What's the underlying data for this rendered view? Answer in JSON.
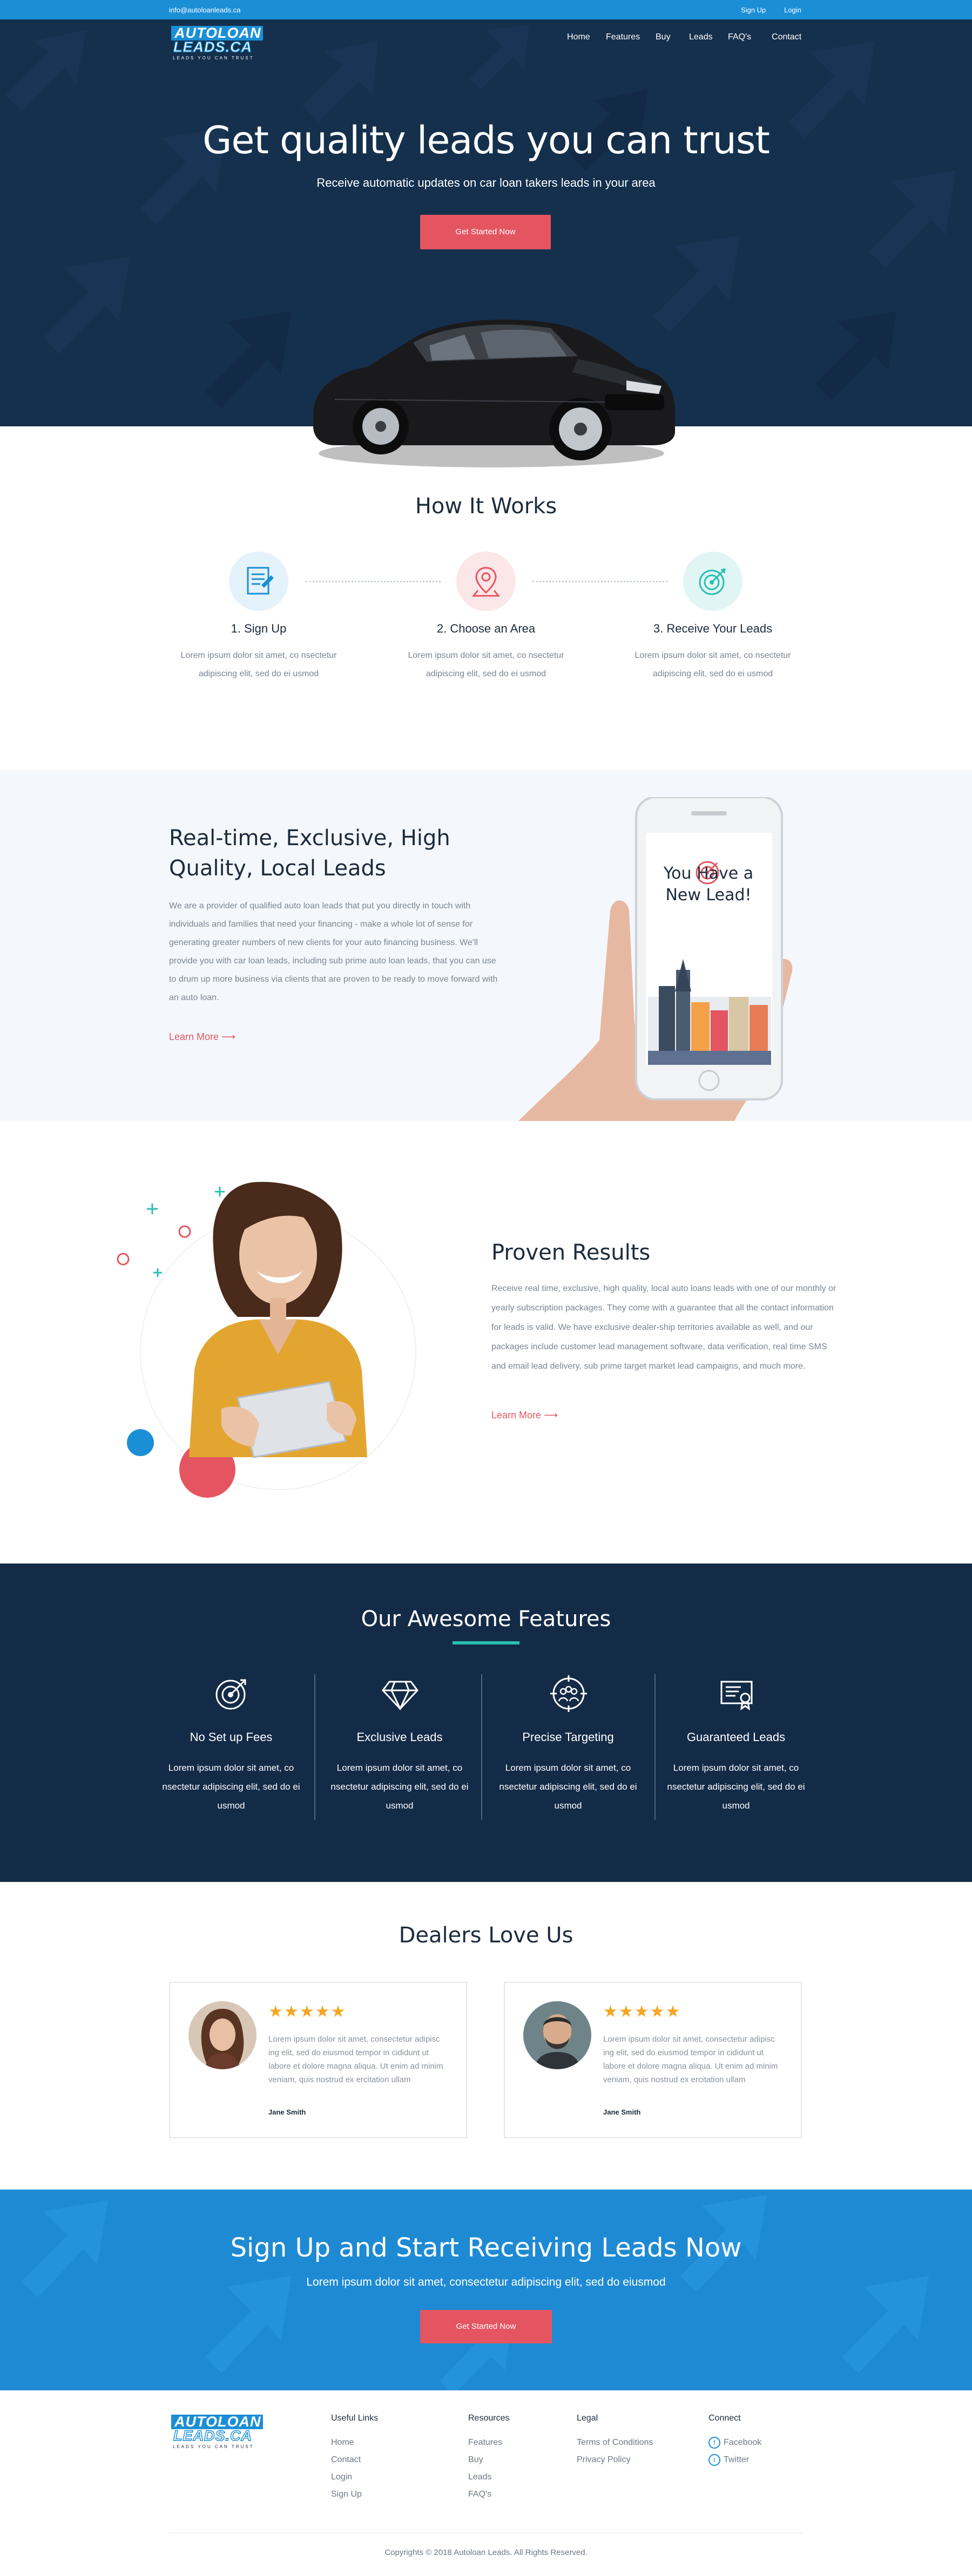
{
  "topbar": {
    "email": "info@autoloanleads.ca",
    "signup": "Sign Up",
    "login": "Login"
  },
  "brand": {
    "line1": "AUTOLOAN",
    "line2": "LEADS.CA",
    "tagline": "LEADS YOU CAN TRUST"
  },
  "nav": {
    "items": [
      "Home",
      "Features",
      "Buy",
      "Leads",
      "FAQ's",
      "Contact"
    ]
  },
  "hero": {
    "title": "Get quality leads you can trust",
    "subtitle": "Receive automatic updates on car loan takers leads in your area",
    "cta": "Get Started Now"
  },
  "how": {
    "title": "How It Works",
    "steps": [
      {
        "title": "1. Sign Up",
        "text": "Lorem ipsum dolor sit amet,  co nsectetur adipiscing elit, sed do ei usmod",
        "icon": "certificate-icon",
        "color": "#1b8fd6",
        "bg": "#e4f2fc"
      },
      {
        "title": "2. Choose an Area",
        "text": "Lorem ipsum dolor sit amet,  co nsectetur adipiscing elit, sed do ei usmod",
        "icon": "map-pin-icon",
        "color": "#e45561",
        "bg": "#fbe6e8"
      },
      {
        "title": "3. Receive Your Leads",
        "text": "Lorem ipsum dolor sit amet,  co nsectetur adipiscing elit, sed do ei usmod",
        "icon": "target-icon",
        "color": "#2bbfb2",
        "bg": "#e1f6f4"
      }
    ]
  },
  "realtime": {
    "title": "Real-time, Exclusive, High Quality, Local Leads",
    "text": "We are a provider of qualified auto loan leads that put you directly in touch with individuals and families that need your financing - make a whole lot of sense for generating greater numbers of new clients for your auto financing business. We'll provide you with car loan leads, including sub prime auto loan leads, that you can use to drum up more business via clients that are proven to be ready to move forward with an auto loan.",
    "link": "Learn More",
    "phone_text": "You Have a New Lead!"
  },
  "proven": {
    "title": "Proven Results",
    "text": "Receive real time, exclusive, high quality, local auto loans leads with one of our monthly or yearly subscription packages. They come with a guarantee that all the contact information for leads is valid. We have exclusive dealer-ship territories available as well, and our packages include customer lead management software, data verification, real time SMS and email lead delivery, sub prime target market lead campaigns, and much more.",
    "link": "Learn More"
  },
  "features": {
    "title": "Our Awesome Features",
    "items": [
      {
        "name": "No Set up Fees",
        "text": "Lorem ipsum dolor sit amet, co nsectetur adipiscing elit, sed do ei usmod",
        "icon": "target-icon"
      },
      {
        "name": "Exclusive Leads",
        "text": "Lorem ipsum dolor sit amet, co nsectetur adipiscing elit, sed do ei usmod",
        "icon": "diamond-icon"
      },
      {
        "name": "Precise Targeting",
        "text": "Lorem ipsum dolor sit amet, co nsectetur adipiscing elit, sed do ei usmod",
        "icon": "group-target-icon"
      },
      {
        "name": "Guaranteed Leads",
        "text": "Lorem ipsum dolor sit amet, co nsectetur adipiscing elit, sed do ei usmod",
        "icon": "certificate-icon"
      }
    ]
  },
  "dealers": {
    "title": "Dealers Love Us",
    "reviews": [
      {
        "stars": "★★★★★",
        "rating": 5,
        "text": "Lorem ipsum dolor sit amet, consectetur adipisc ing elit, sed do eiusmod tempor in cididunt ut labore et dolore magna aliqua. Ut enim ad minim veniam, quis nostrud ex ercitation ullam",
        "name": "Jane Smith"
      },
      {
        "stars": "★★★★★",
        "rating": 5,
        "text": "Lorem ipsum dolor sit amet, consectetur adipisc ing elit, sed do eiusmod tempor in cididunt ut labore et dolore magna aliqua. Ut enim ad minim veniam, quis nostrud ex ercitation ullam",
        "name": "Jane Smith"
      }
    ]
  },
  "cta": {
    "title": "Sign Up and Start Receiving Leads Now",
    "subtitle": "Lorem ipsum dolor sit amet, consectetur adipiscing elit, sed do eiusmod",
    "button": "Get Started Now"
  },
  "footer": {
    "useful": {
      "title": "Useful Links",
      "links": [
        "Home",
        "Contact",
        "Login",
        "Sign Up"
      ]
    },
    "resources": {
      "title": "Resources",
      "links": [
        "Features",
        "Buy",
        "Leads",
        "FAQ's"
      ]
    },
    "legal": {
      "title": "Legal",
      "links": [
        "Terms of Conditions",
        "Privacy Policy"
      ]
    },
    "connect": {
      "title": "Connect",
      "links": [
        "Facebook",
        "Twitter"
      ]
    },
    "copyright": "Copyrights © 2018 Autoloan Leads. All Rights Reserved."
  },
  "colors": {
    "primary": "#1b8fd6",
    "navy": "#142b47",
    "accent": "#e45561",
    "teal": "#2bbfb2"
  }
}
